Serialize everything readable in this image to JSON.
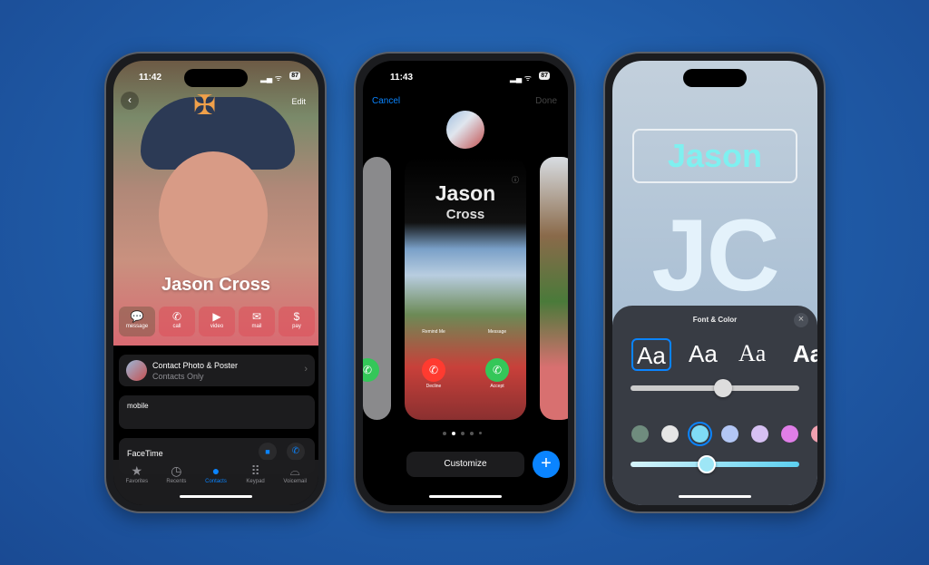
{
  "phone1": {
    "time": "11:42",
    "battery": "87",
    "back_icon": "chevron-left-icon",
    "edit_label": "Edit",
    "contact_name": "Jason Cross",
    "actions": [
      {
        "label": "message",
        "icon": "💬"
      },
      {
        "label": "call",
        "icon": "📞"
      },
      {
        "label": "video",
        "icon": "📹"
      },
      {
        "label": "mail",
        "icon": "✉"
      },
      {
        "label": "pay",
        "icon": "$"
      }
    ],
    "poster_card": {
      "title": "Contact Photo & Poster",
      "subtitle": "Contacts Only"
    },
    "mobile_label": "mobile",
    "facetime_label": "FaceTime",
    "tabs": [
      {
        "label": "Favorites",
        "icon": "★"
      },
      {
        "label": "Recents",
        "icon": "◷"
      },
      {
        "label": "Contacts",
        "icon": "●",
        "active": true
      },
      {
        "label": "Keypad",
        "icon": "⠿"
      },
      {
        "label": "Voicemail",
        "icon": "⌓"
      }
    ]
  },
  "phone2": {
    "time": "11:43",
    "battery": "87",
    "cancel_label": "Cancel",
    "done_label": "Done",
    "poster_first": "Jason",
    "poster_last": "Cross",
    "call_buttons": {
      "remind": "Remind Me",
      "message": "Message",
      "decline": "Decline",
      "accept": "Accept"
    },
    "page_count": 5,
    "current_page": 2,
    "customize_label": "Customize",
    "add_icon": "+"
  },
  "phone3": {
    "name_preview": "Jason",
    "monogram": "JC",
    "panel_title": "Font & Color",
    "close_icon": "×",
    "fonts": [
      "Aa",
      "Aa",
      "Aa",
      "Aa"
    ],
    "selected_font": 0,
    "weight_slider": 0.55,
    "colors": [
      "#6f8c7e",
      "#e6e6e6",
      "#7fdcf5",
      "#b3c7f5",
      "#d6c0f2",
      "#e07ee8",
      "#f0a0b0"
    ],
    "selected_color": 2,
    "color_slider": 0.45
  },
  "colors": {
    "accent": "#0a84ff",
    "background": "#1f5aa6",
    "accept": "#34c759",
    "decline": "#ff3b30"
  }
}
